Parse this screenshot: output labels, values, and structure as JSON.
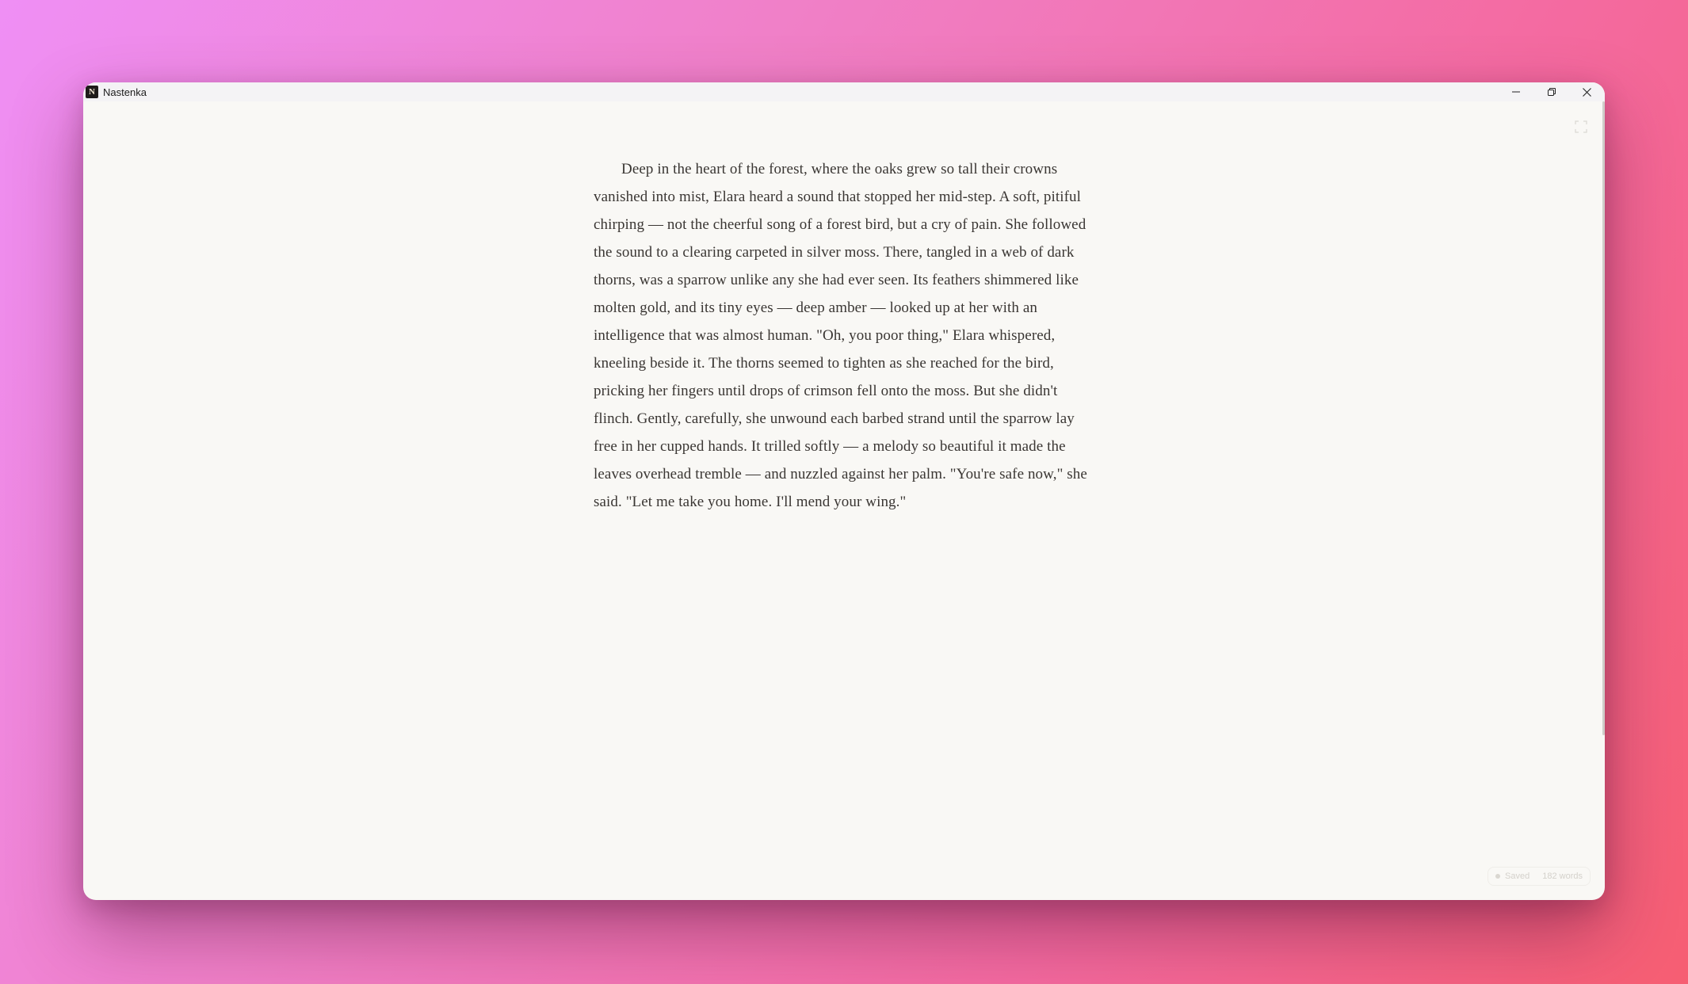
{
  "window": {
    "app_name": "Nastenka",
    "app_icon_letter": "N",
    "controls": {
      "minimize_icon": "minimize-icon",
      "maximize_icon": "restore-icon",
      "close_icon": "close-icon"
    }
  },
  "toolbar": {
    "fullscreen_icon": "fullscreen-icon"
  },
  "editor": {
    "text": "Deep in the heart of the forest, where the oaks grew so tall their crowns vanished into mist, Elara heard a sound that stopped her mid-step. A soft, pitiful chirping — not the cheerful song of a forest bird, but a cry of pain. She followed the sound to a clearing carpeted in silver moss. There, tangled in a web of dark thorns, was a sparrow unlike any she had ever seen. Its feathers shimmered like molten gold, and its tiny eyes — deep amber — looked up at her with an intelligence that was almost human. \"Oh, you poor thing,\" Elara whispered, kneeling beside it. The thorns seemed to tighten as she reached for the bird, pricking her fingers until drops of crimson fell onto the moss. But she didn't flinch. Gently, carefully, she unwound each barbed strand until the sparrow lay free in her cupped hands. It trilled softly — a melody so beautiful it made the leaves overhead tremble — and nuzzled against her palm. \"You're safe now,\" she said. \"Let me take you home. I'll mend your wing.\""
  },
  "status": {
    "saved_label": "Saved",
    "word_count": "182 words"
  },
  "colors": {
    "page_background": "#f9f8f5",
    "text": "#3a3633",
    "titlebar": "#f4f3f5",
    "desktop_gradient_start": "#ef8ff5",
    "desktop_gradient_end": "#f65e72"
  }
}
